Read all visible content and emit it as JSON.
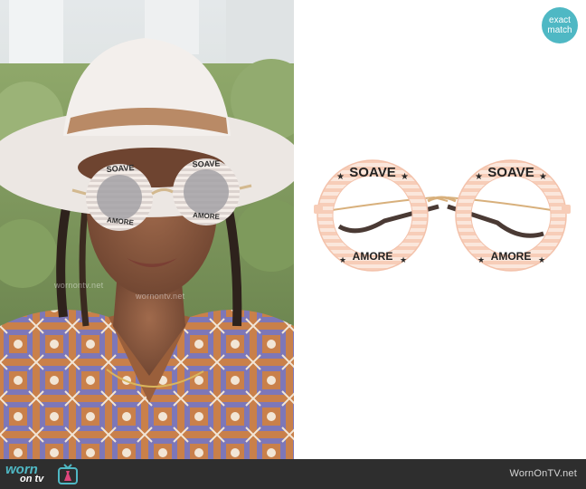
{
  "badge": {
    "line1": "exact",
    "line2": "match",
    "color": "#4fb8c4"
  },
  "product": {
    "top_text": "SOAVE",
    "bottom_text": "AMORE",
    "frame_color": "#f7cdb8",
    "stripe_color": "#fbe7dc"
  },
  "photo": {
    "glasses_top_text": "SOAVE",
    "glasses_bottom_text": "AMORE"
  },
  "footer": {
    "logo_line1": "worn",
    "logo_line2": "on tv",
    "url": "WornOnTV.net",
    "bg_color": "#2e2e2e"
  },
  "watermark": "wornontv.net"
}
